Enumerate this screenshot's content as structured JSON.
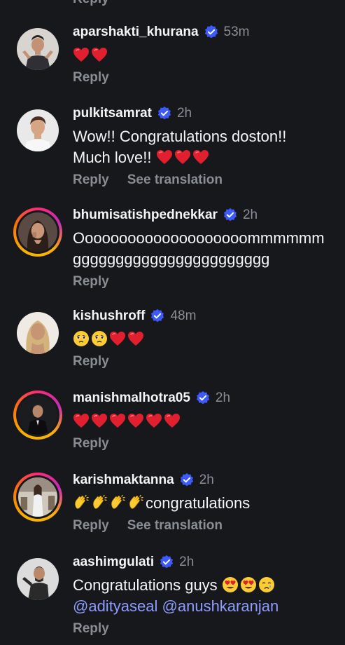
{
  "top": {
    "reply_label": "Reply"
  },
  "colors": {
    "background": "#17181c",
    "text": "#f5f5f5",
    "muted": "#8a8d92",
    "verified": "#3d5afe",
    "mention": "#8c9cff",
    "story_ring": "#f9b300"
  },
  "comments": [
    {
      "username": "aparshakti_khurana",
      "time": "53m",
      "text_parts": [],
      "emojis": [
        "red-heart",
        "red-heart"
      ],
      "reply_label": "Reply"
    },
    {
      "username": "pulkitsamrat",
      "time": "2h",
      "text_line1": "Wow!! Congratulations doston!!",
      "text_line2": "Much love!!",
      "emojis": [
        "red-heart",
        "red-heart",
        "red-heart"
      ],
      "reply_label": "Reply",
      "translate_label": "See translation"
    },
    {
      "username": "bhumisatishpednekkar",
      "time": "2h",
      "text_line1": "Oooooooooooooooooooommmmmm",
      "text_line2": "ggggggggggggggggggggggg",
      "reply_label": "Reply"
    },
    {
      "username": "kishushroff",
      "time": "48m",
      "emojis": [
        "teary-face",
        "teary-face",
        "red-heart",
        "red-heart"
      ],
      "reply_label": "Reply"
    },
    {
      "username": "manishmalhotra05",
      "time": "2h",
      "emojis": [
        "red-heart",
        "red-heart",
        "red-heart",
        "red-heart",
        "red-heart",
        "red-heart"
      ],
      "reply_label": "Reply"
    },
    {
      "username": "karishmaktanna",
      "time": "2h",
      "emojis": [
        "clapping-hands",
        "clapping-hands",
        "clapping-hands",
        "clapping-hands"
      ],
      "text_after": "congratulations",
      "reply_label": "Reply",
      "translate_label": "See translation"
    },
    {
      "username": "aashimgulati",
      "time": "2h",
      "text_line1": "Congratulations guys",
      "emojis": [
        "heart-eyes",
        "heart-eyes",
        "crying-face"
      ],
      "mention1": "@adityaseal",
      "mention2": "@anushkaranjan",
      "reply_label": "Reply"
    }
  ]
}
